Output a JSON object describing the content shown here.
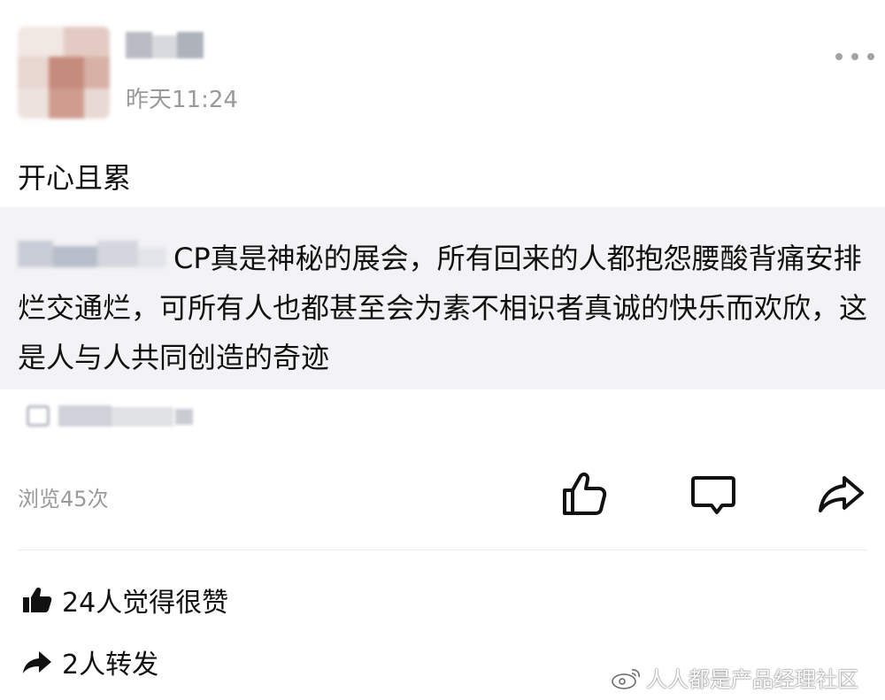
{
  "post": {
    "timestamp": "昨天11:24",
    "text": "开心且累",
    "quoted": {
      "text": "CP真是神秘的展会，所有回来的人都抱怨腰酸背痛安排烂交通烂，可所有人也都甚至会为素不相识者真诚的快乐而欢欣，这是人与人共同创造的奇迹"
    },
    "view_count": "浏览45次"
  },
  "actions": {
    "like_icon": "thumbs-up-icon",
    "comment_icon": "comment-icon",
    "share_icon": "share-icon",
    "more_icon": "more-dots-icon"
  },
  "stats": {
    "likes": "24人觉得很赞",
    "reposts": "2人转发"
  },
  "watermark": {
    "text": "人人都是产品经理社区"
  },
  "colors": {
    "quote_bg": "#f3f3f5",
    "muted_text": "#9a9a9a",
    "primary_text": "#111111"
  }
}
